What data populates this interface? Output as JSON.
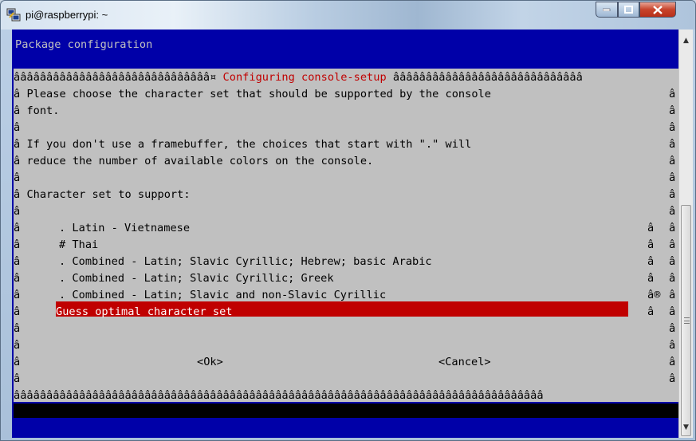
{
  "window": {
    "title": "pi@raspberrypi: ~"
  },
  "terminal": {
    "header": "Package configuration",
    "dialog_title": "Configuring console-setup",
    "border_char": "â",
    "top_left_border": "ââââââââââââââââââââââââââââââ¤ ",
    "top_right_border": " âââââââââââââââââââââââââââââ",
    "bottom_border": "âââââââââââââââââââââââââââââââââââââââââââââââââââââââââââââââââââââââââââââââââ",
    "description_lines": [
      "Please choose the character set that should be supported by the console",
      "font.",
      "",
      "If you don't use a framebuffer, the choices that start with \".\" will",
      "reduce the number of available colors on the console.",
      "",
      "Character set to support:",
      ""
    ],
    "options": [
      {
        "label": ". Latin - Vietnamese",
        "marker": "â"
      },
      {
        "label": "# Thai",
        "marker": "â"
      },
      {
        "label": ". Combined - Latin; Slavic Cyrillic; Hebrew; basic Arabic",
        "marker": "â"
      },
      {
        "label": ". Combined - Latin; Slavic Cyrillic; Greek",
        "marker": "â"
      },
      {
        "label": ". Combined - Latin; Slavic and non-Slavic Cyrillic",
        "marker": "â®"
      },
      {
        "label": "Guess optimal character set",
        "marker": "â",
        "selected": true
      }
    ],
    "ok_button": "<Ok>",
    "cancel_button": "<Cancel>"
  },
  "colors": {
    "terminal_bg": "#0000a8",
    "dialog_bg": "#c0c0c0",
    "title_red": "#c00000",
    "selection_bg": "#c00000"
  }
}
